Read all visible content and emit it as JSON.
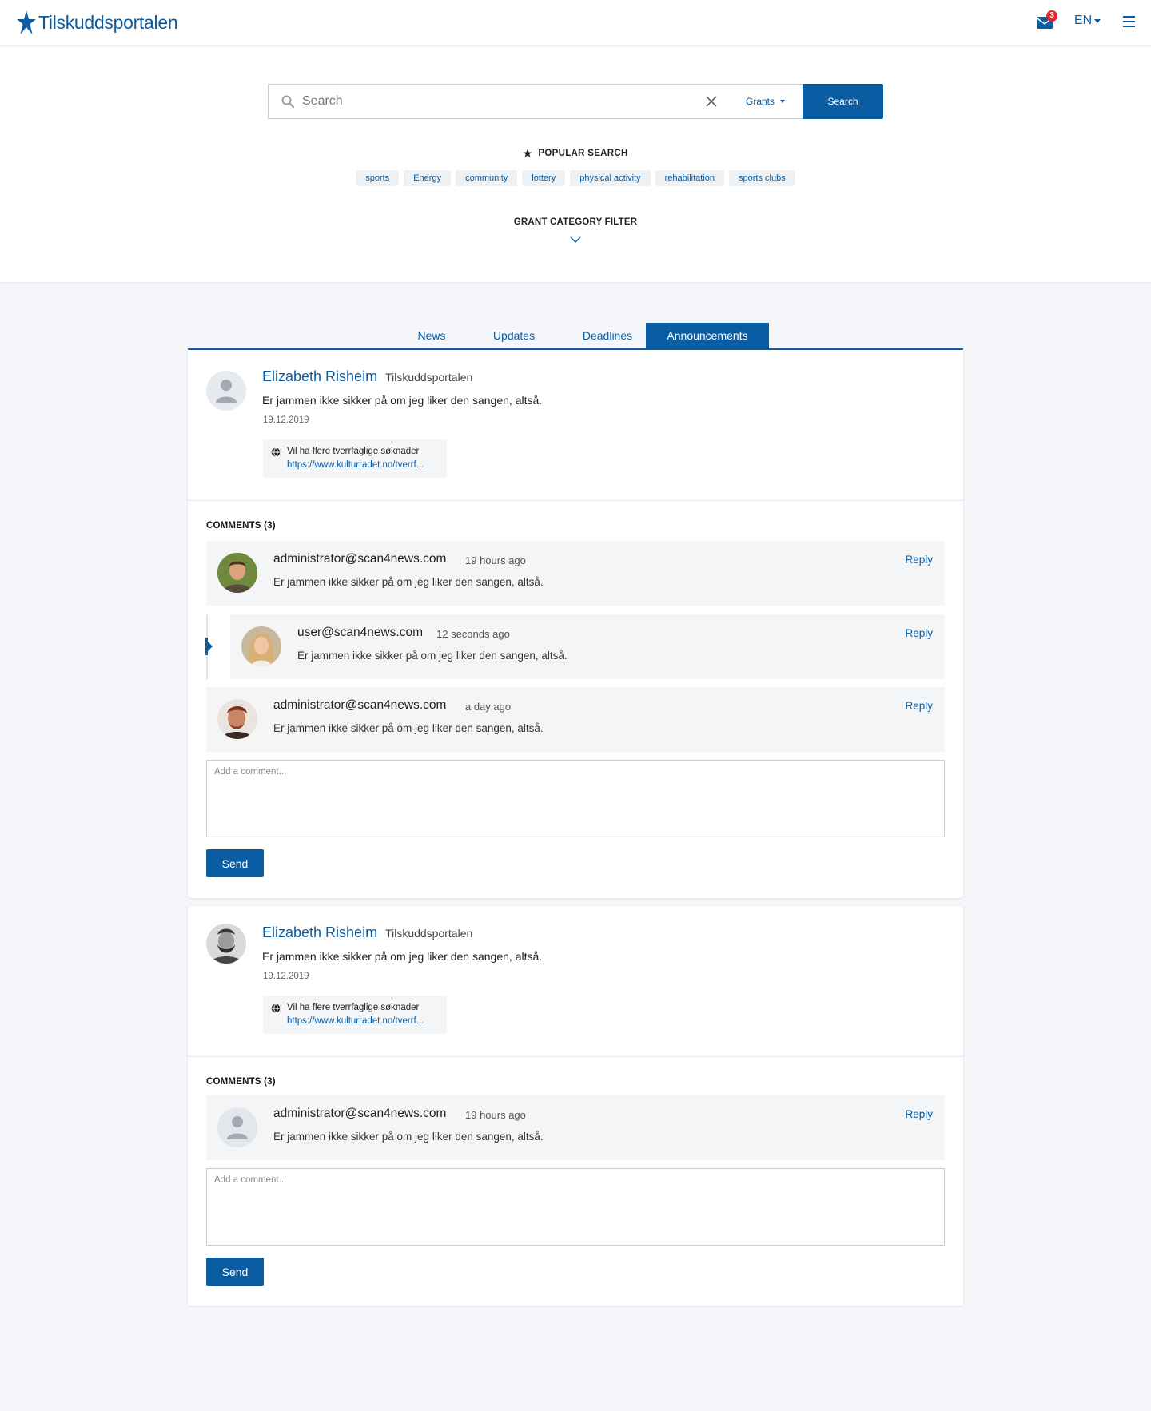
{
  "header": {
    "brand": "Tilskuddsportalen",
    "mail_badge": "3",
    "language": "EN"
  },
  "search": {
    "placeholder": "Search",
    "filter_label": "Grants",
    "button_label": "Search",
    "popular_title": "POPULAR SEARCH",
    "popular_tags": [
      "sports",
      "Energy",
      "community",
      "lottery",
      "physical activity",
      "rehabilitation",
      "sports clubs"
    ],
    "category_filter": "GRANT CATEGORY FILTER"
  },
  "tabs": [
    {
      "label": "News",
      "active": false
    },
    {
      "label": "Updates",
      "active": false
    },
    {
      "label": "Deadlines",
      "active": false
    },
    {
      "label": "Announcements",
      "active": true
    }
  ],
  "posts": [
    {
      "author": "Elizabeth Risheim",
      "org": "Tilskuddsportalen",
      "text": "Er jammen ikke sikker på om jeg liker den sangen, altså.",
      "date": "19.12.2019",
      "link_title": "Vil ha flere tverrfaglige søknader",
      "link_url": "https://www.kulturradet.no/tverrf...",
      "comments_title": "COMMENTS (3)",
      "comments": [
        {
          "user": "administrator@scan4news.com",
          "time": "19 hours ago",
          "text": "Er jammen ikke sikker på om jeg liker den sangen, altså.",
          "reply": "Reply"
        },
        {
          "user": "user@scan4news.com",
          "time": "12 seconds ago",
          "text": "Er jammen ikke sikker på om jeg liker den sangen, altså.",
          "reply": "Reply"
        },
        {
          "user": "administrator@scan4news.com",
          "time": "a day ago",
          "text": "Er jammen ikke sikker på om jeg liker den sangen, altså.",
          "reply": "Reply"
        }
      ],
      "comment_placeholder": "Add a comment...",
      "send_label": "Send"
    },
    {
      "author": "Elizabeth Risheim",
      "org": "Tilskuddsportalen",
      "text": "Er jammen ikke sikker på om jeg liker den sangen, altså.",
      "date": "19.12.2019",
      "link_title": "Vil ha flere tverrfaglige søknader",
      "link_url": "https://www.kulturradet.no/tverrf...",
      "comments_title": "COMMENTS (3)",
      "comments": [
        {
          "user": "administrator@scan4news.com",
          "time": "19 hours ago",
          "text": "Er jammen ikke sikker på om jeg liker den sangen, altså.",
          "reply": "Reply"
        }
      ],
      "comment_placeholder": "Add a comment...",
      "send_label": "Send"
    }
  ],
  "colors": {
    "brand": "#0b5da3",
    "badge": "#e0262e",
    "page_bg": "#f4f6f9",
    "comment_bg": "#f3f5f7"
  }
}
